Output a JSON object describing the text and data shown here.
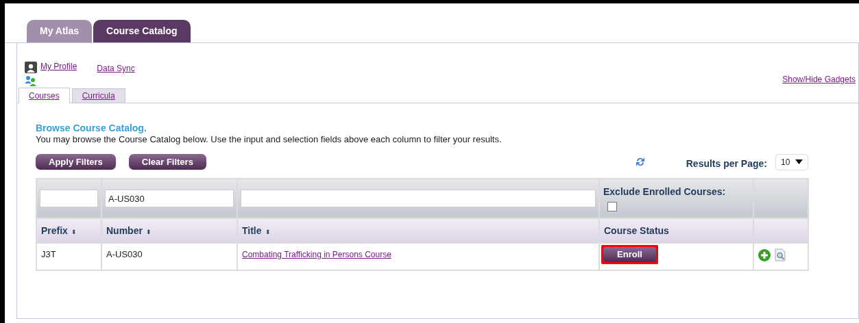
{
  "main_tabs": [
    {
      "label": "My Atlas",
      "selected": false
    },
    {
      "label": "Course Catalog",
      "selected": true
    }
  ],
  "profile_links": [
    {
      "label": "My Profile"
    },
    {
      "label": "Data Sync"
    }
  ],
  "gadgets_link": "Show/Hide Gadgets",
  "sub_tabs": [
    {
      "label": "Courses",
      "selected": true
    },
    {
      "label": "Curricula",
      "selected": false
    }
  ],
  "heading": "Browse Course Catalog.",
  "description": "You may browse the Course Catalog below. Use the input and selection fields above each column to filter your results.",
  "filter_buttons": [
    "Apply Filters",
    "Clear Filters"
  ],
  "results_per_page": {
    "label": "Results per Page:",
    "value": "10"
  },
  "table": {
    "filters": [
      {
        "kind": "text"
      },
      {
        "kind": "text",
        "value": "A-US030"
      },
      {
        "kind": "text"
      }
    ],
    "exclude_enrolled": {
      "label": "Exclude Enrolled Courses:",
      "checked": false
    },
    "columns": [
      {
        "label": "Prefix",
        "sort_glyph": "⬍"
      },
      {
        "label": "Number",
        "sort_glyph": "⬍"
      },
      {
        "label": "Title",
        "sort_glyph": "⬍"
      },
      {
        "label": "Course Status"
      }
    ],
    "rows": [
      {
        "prefix": "J3T",
        "number": "A-US030",
        "title": "Combating Trafficking in Persons Course",
        "action": "Enroll",
        "highlighted": true
      }
    ]
  }
}
